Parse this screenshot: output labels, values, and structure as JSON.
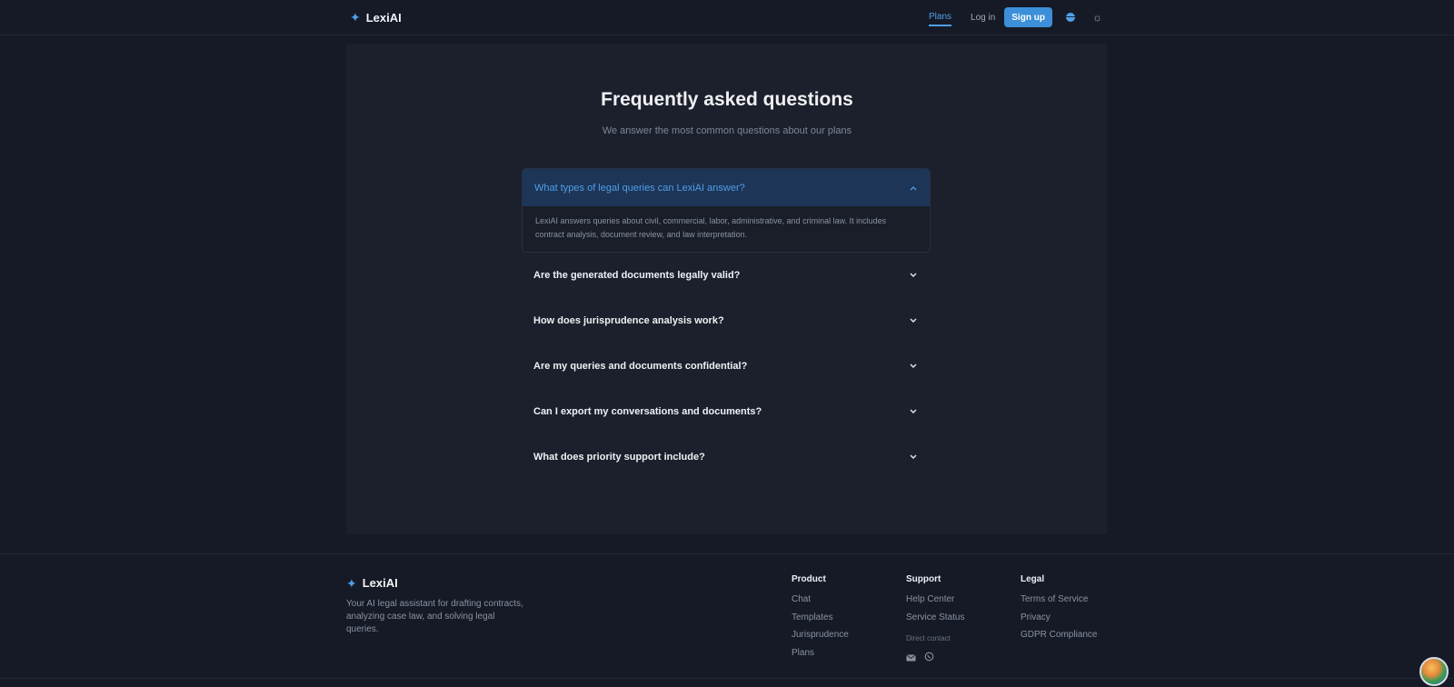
{
  "header": {
    "brand_name": "LexiAI",
    "nav": {
      "plans": "Plans",
      "login": "Log in",
      "signup": "Sign up"
    },
    "accent_color": "#4f9fe8"
  },
  "faq": {
    "title": "Frequently asked questions",
    "subtitle": "We answer the most common questions about our plans",
    "open_item": {
      "question": "What types of legal queries can LexiAI answer?",
      "answer": "LexiAI answers queries about civil, commercial, labor, administrative, and criminal law. It includes contract analysis, document review, and law interpretation."
    },
    "items": [
      {
        "question": "Are the generated documents legally valid?"
      },
      {
        "question": "How does jurisprudence analysis work?"
      },
      {
        "question": "Are my queries and documents confidential?"
      },
      {
        "question": "Can I export my conversations and documents?"
      },
      {
        "question": "What does priority support include?"
      }
    ]
  },
  "footer": {
    "brand_name": "LexiAI",
    "description": "Your AI legal assistant for drafting contracts, analyzing case law, and solving legal queries.",
    "product": {
      "heading": "Product",
      "links": [
        "Chat",
        "Templates",
        "Jurisprudence",
        "Plans"
      ]
    },
    "support": {
      "heading": "Support",
      "links": [
        "Help Center",
        "Service Status"
      ],
      "direct_contact": "Direct contact"
    },
    "legal": {
      "heading": "Legal",
      "links": [
        "Terms of Service",
        "Privacy",
        "GDPR Compliance"
      ]
    }
  }
}
